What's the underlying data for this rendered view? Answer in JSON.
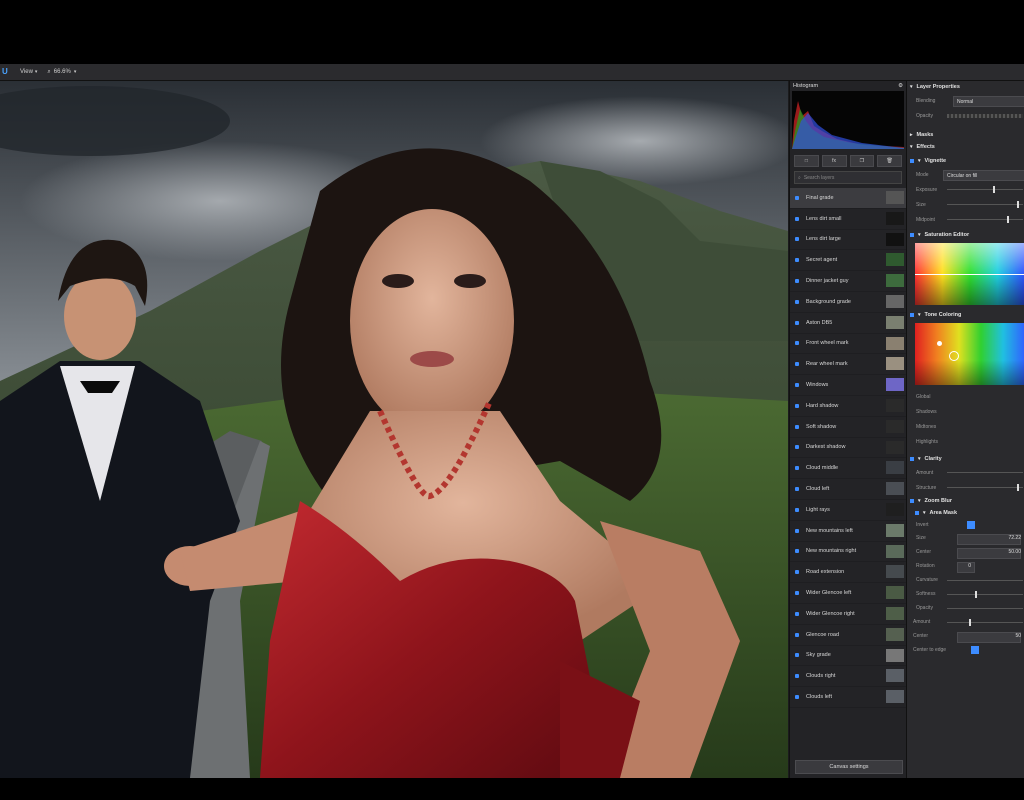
{
  "toolbar": {
    "logo": "U",
    "view_label": "View",
    "zoom_label": "66.6%"
  },
  "histogram": {
    "title": "Histogram"
  },
  "layers_panel": {
    "tools": [
      "□",
      "fx",
      "❐",
      "🗑"
    ],
    "search_placeholder": "Search layers",
    "items": [
      {
        "label": "Final grade",
        "selected": true
      },
      {
        "label": "Lens dirt small"
      },
      {
        "label": "Lens dirt large"
      },
      {
        "label": "Secret agent"
      },
      {
        "label": "Dinner jacket guy"
      },
      {
        "label": "Background grade"
      },
      {
        "label": "Aston DB5"
      },
      {
        "label": "Front wheel mark"
      },
      {
        "label": "Rear wheel mark"
      },
      {
        "label": "Windows"
      },
      {
        "label": "Hard shadow"
      },
      {
        "label": "Soft shadow"
      },
      {
        "label": "Darkest shadow"
      },
      {
        "label": "Cloud middle"
      },
      {
        "label": "Cloud left"
      },
      {
        "label": "Light rays"
      },
      {
        "label": "New mountains left"
      },
      {
        "label": "New mountains right"
      },
      {
        "label": "Road extension"
      },
      {
        "label": "Wider Glencoe left"
      },
      {
        "label": "Wider Glencoe right"
      },
      {
        "label": "Glencoe road"
      },
      {
        "label": "Sky grade"
      },
      {
        "label": "Clouds right"
      },
      {
        "label": "Clouds left"
      }
    ],
    "canvas_settings_label": "Canvas settings"
  },
  "properties": {
    "layer_properties_title": "Layer Properties",
    "blending_label": "Blending",
    "blending_value": "Normal",
    "opacity_label": "Opacity",
    "masks_label": "Masks",
    "effects_label": "Effects",
    "vignette": {
      "title": "Vignette",
      "mode_label": "Mode",
      "mode_value": "Circular on fill",
      "exposure_label": "Exposure",
      "size_label": "Size",
      "midpoint_label": "Midpoint"
    },
    "saturation_editor_title": "Saturation Editor",
    "tone_coloring": {
      "title": "Tone Coloring",
      "global_label": "Global",
      "shadows_label": "Shadows",
      "midtones_label": "Midtones",
      "highlights_label": "Highlights"
    },
    "clarity": {
      "title": "Clarity",
      "amount_label": "Amount",
      "structure_label": "Structure"
    },
    "zoom_blur": {
      "title": "Zoom Blur",
      "area_mask_title": "Area Mask",
      "invert_label": "Invert",
      "size_label": "Size",
      "size_value": "72.22",
      "center_label": "Center",
      "center_value": "50.00",
      "rotation_label": "Rotation",
      "rotation_value": "0",
      "curvature_label": "Curvature",
      "softness_label": "Softness",
      "opacity_label": "Opacity",
      "amount_label": "Amount",
      "center2_label": "Center",
      "center2_value": "50",
      "center_to_edge_label": "Center to edge"
    }
  },
  "colors": {
    "accent": "#3d8cff",
    "panel": "#232326",
    "dress": "#9b1a22"
  }
}
